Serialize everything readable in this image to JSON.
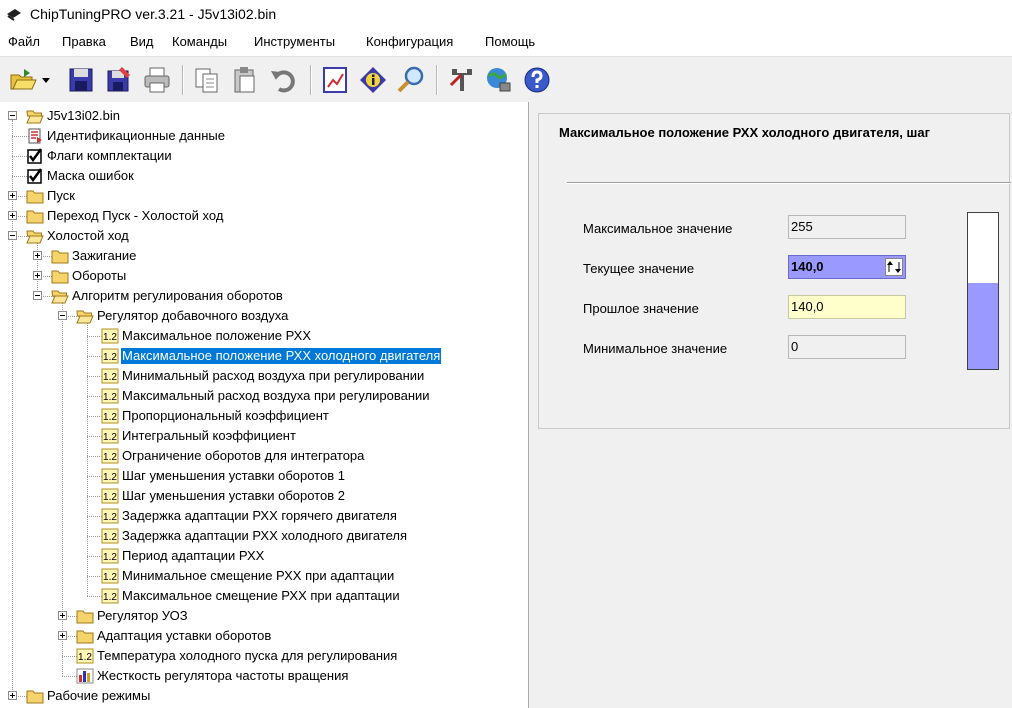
{
  "window": {
    "title": "ChipTuningPRO ver.3.21 - J5v13i02.bin"
  },
  "menu": [
    "Файл",
    "Правка",
    "Вид",
    "Команды",
    "Инструменты",
    "Конфигурация",
    "Помощь"
  ],
  "toolbar": {
    "buttons": [
      "open-icon",
      "save-icon",
      "save-as-icon",
      "print-icon",
      "copy-icon",
      "paste-icon",
      "undo-icon",
      "chart-icon",
      "info-icon",
      "search-icon",
      "tools-icon",
      "connect-icon",
      "help-icon"
    ]
  },
  "tree": {
    "root": "J5v13i02.bin",
    "items": [
      "Идентификационные данные",
      "Флаги комплектации",
      "Маска ошибок",
      "Пуск",
      "Переход Пуск - Холостой ход",
      "Холостой ход",
      "Зажигание",
      "Обороты",
      "Алгоритм регулирования оборотов",
      "Регулятор добавочного воздуха",
      "Максимальное положение РХХ",
      "Максимальное положение РХХ холодного двигателя",
      "Минимальный расход воздуха при регулировании",
      "Максимальный расход воздуха при регулировании",
      "Пропорциональный коэффициент",
      "Интегральный коэффициент",
      "Ограничение оборотов для интегратора",
      "Шаг уменьшения уставки оборотов 1",
      "Шаг уменьшения уставки оборотов 2",
      "Задержка адаптации РХХ горячего двигателя",
      "Задержка адаптации РХХ холодного двигателя",
      "Период адаптации РХХ",
      "Минимальное смещение РХХ при адаптации",
      "Максимальное смещение РХХ при адаптации",
      "Регулятор УОЗ",
      "Адаптация уставки оборотов",
      "Температура холодного пуска для регулирования",
      "Жесткость регулятора частоты вращения",
      "Рабочие режимы"
    ],
    "value_badge": "1.2"
  },
  "detail": {
    "title": "Максимальное положение РХХ холодного двигателя, шаг",
    "max_label": "Максимальное значение",
    "max_value": "255",
    "current_label": "Текущее значение",
    "current_value": "140,0",
    "previous_label": "Прошлое значение",
    "previous_value": "140,0",
    "min_label": "Минимальное значение",
    "min_value": "0",
    "gauge_fraction": 0.549,
    "gauge_color": "#9999ff"
  }
}
